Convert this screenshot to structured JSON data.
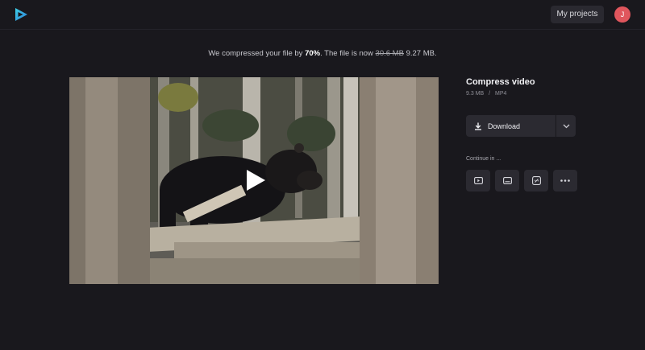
{
  "header": {
    "logo_icon": "play-logo-icon",
    "projects_label": "My projects",
    "avatar_initial": "J",
    "avatar_color": "#e0565d"
  },
  "status": {
    "prefix": "We compressed your file by ",
    "percent": "70%",
    "middle": ". The file is now ",
    "old_size": "30.6 MB",
    "new_size": "9.27 MB."
  },
  "player": {
    "play_icon": "play-icon"
  },
  "panel": {
    "title": "Compress video",
    "size": "9.3 MB",
    "separator": "/",
    "format": "MP4",
    "download_label": "Download",
    "continue_label": "Continue in ...",
    "share_icons": [
      "video-editor-icon",
      "subtitles-icon",
      "link-icon",
      "more-icon"
    ]
  },
  "colors": {
    "background": "#19181d",
    "button": "#2b2a31",
    "accent": "#2bb5d6"
  }
}
